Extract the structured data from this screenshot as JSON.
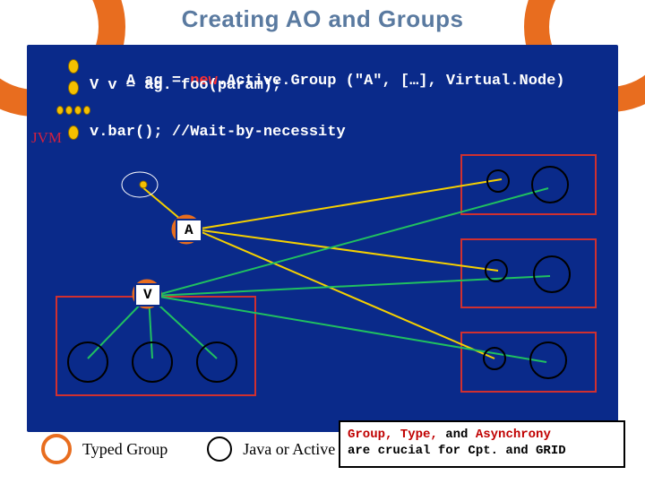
{
  "title": "Creating AO and Groups",
  "jvm_label": "JVM",
  "code": {
    "line1_a": "A ag = ",
    "line1_kw": "new",
    "line1_b": ".Active.Group (\"A\", […], Virtual.Node)",
    "line2": "V v = ag. foo(param);",
    "line3": "v.bar(); //Wait-by-necessity"
  },
  "group_labels": {
    "A": "A",
    "V": "V"
  },
  "legend": {
    "typed_group": "Typed Group",
    "java_ao": "Java or Active Object"
  },
  "footer_note": {
    "part1": "Group, Type,",
    "part2": " and ",
    "part3": "Asynchrony",
    "part4": "are crucial for Cpt. and GRID"
  },
  "colors": {
    "panel": "#0a2a8a",
    "accent_orange": "#e86d1f",
    "yellow_line": "#f5d000",
    "green_line": "#20c060",
    "red_box": "#d03030",
    "keyword": "#ff3030"
  }
}
